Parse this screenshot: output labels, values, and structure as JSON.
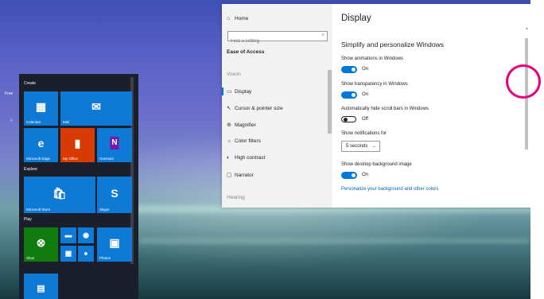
{
  "desktop": {
    "free_label": "Free",
    "chevron": "˅"
  },
  "start_menu": {
    "groups": [
      {
        "label": "Create",
        "top": 0
      },
      {
        "label": "Explore",
        "top": 0
      },
      {
        "label": "Play",
        "top": 0
      }
    ],
    "tiles": {
      "calendar": {
        "label": "Calendar",
        "icon": "calendar-icon"
      },
      "mail": {
        "label": "Mail",
        "icon": "mail-icon"
      },
      "edge": {
        "label": "Microsoft Edge",
        "icon": "edge-icon"
      },
      "office": {
        "label": "My Office",
        "icon": "office-icon"
      },
      "onenote": {
        "label": "OneNote",
        "icon": "onenote-icon"
      },
      "store": {
        "label": "Microsoft Store",
        "icon": "store-icon"
      },
      "skype": {
        "label": "Skype",
        "icon": "skype-icon"
      },
      "xbox": {
        "label": "Xbox",
        "icon": "xbox-icon"
      },
      "photos": {
        "label": "Photos",
        "icon": "photos-icon"
      }
    },
    "colors": {
      "tile_blue": "#0f79d6",
      "xbox_green": "#107c10",
      "office_orange": "#d83b01",
      "onenote_purple": "#7719aa"
    }
  },
  "settings": {
    "nav": {
      "home": "Home",
      "search_placeholder": "Find a setting",
      "section": "Ease of Access",
      "group_vision": "Vision",
      "items": [
        {
          "label": "Display",
          "icon": "display-icon"
        },
        {
          "label": "Cursor & pointer size",
          "icon": "cursor-icon"
        },
        {
          "label": "Magnifier",
          "icon": "magnifier-icon"
        },
        {
          "label": "Color filters",
          "icon": "color-filters-icon"
        },
        {
          "label": "High contrast",
          "icon": "high-contrast-icon"
        },
        {
          "label": "Narrator",
          "icon": "narrator-icon"
        }
      ],
      "group_hearing": "Hearing"
    },
    "content": {
      "title": "Display",
      "section_title": "Simplify and personalize Windows",
      "show_animations": {
        "label": "Show animations in Windows",
        "state": "On"
      },
      "show_transparency": {
        "label": "Show transparency in Windows",
        "state": "On"
      },
      "hide_scrollbars": {
        "label": "Automatically hide scroll bars in Windows",
        "state": "Off"
      },
      "notifications": {
        "label": "Show notifications for",
        "value": "5 seconds"
      },
      "background_image": {
        "label": "Show desktop background image",
        "state": "On"
      },
      "link": "Personalize your background and other colors"
    },
    "colors": {
      "accent": "#0078d7",
      "highlight_ring": "#e6007e"
    }
  }
}
